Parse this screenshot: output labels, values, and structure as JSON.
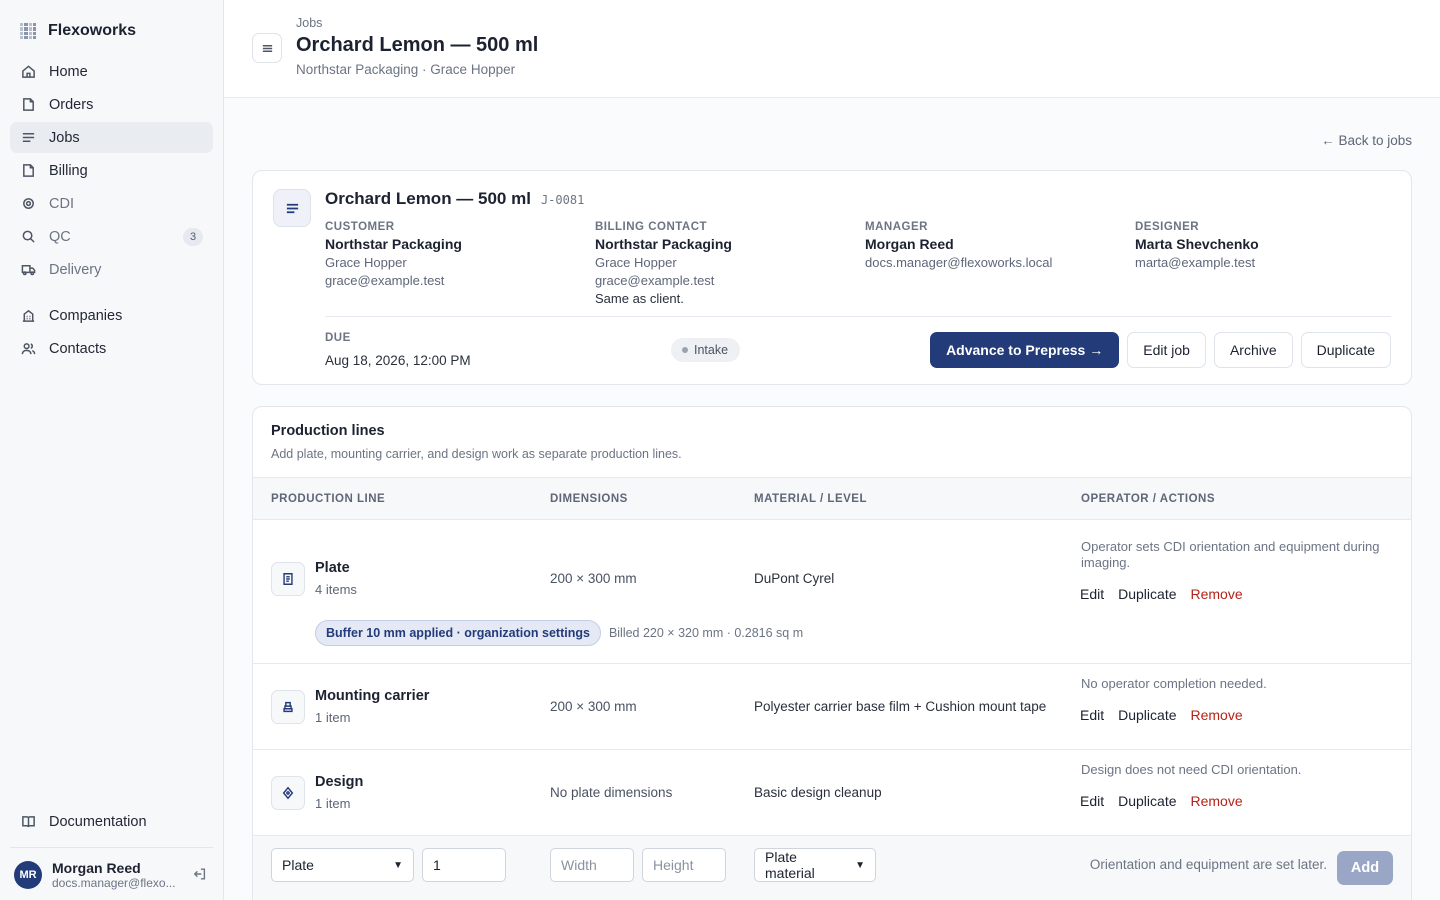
{
  "brand": {
    "name": "Flexoworks"
  },
  "nav": {
    "items": [
      {
        "label": "Home",
        "icon": "home-icon"
      },
      {
        "label": "Orders",
        "icon": "folder-icon"
      },
      {
        "label": "Jobs",
        "icon": "list-icon",
        "active": true
      },
      {
        "label": "Billing",
        "icon": "folder-icon"
      },
      {
        "label": "CDI",
        "icon": "target-icon"
      },
      {
        "label": "QC",
        "icon": "search-icon",
        "badge": "3"
      },
      {
        "label": "Delivery",
        "icon": "truck-icon"
      },
      {
        "label": "Companies",
        "icon": "building-icon"
      },
      {
        "label": "Contacts",
        "icon": "users-icon"
      }
    ],
    "documentation": "Documentation"
  },
  "user": {
    "initials": "MR",
    "name": "Morgan Reed",
    "email": "docs.manager@flexo..."
  },
  "header": {
    "breadcrumb": "Jobs",
    "title": "Orchard Lemon — 500 ml",
    "subtitle": "Northstar Packaging · Grace Hopper"
  },
  "back_link": "← Back to jobs",
  "job": {
    "title": "Orchard Lemon — 500 ml",
    "id": "J-0081",
    "customer": {
      "label": "CUSTOMER",
      "company": "Northstar Packaging",
      "person": "Grace Hopper",
      "email": "grace@example.test"
    },
    "billing": {
      "label": "BILLING CONTACT",
      "company": "Northstar Packaging",
      "person": "Grace Hopper",
      "email": "grace@example.test",
      "note": "Same as client."
    },
    "manager": {
      "label": "MANAGER",
      "name": "Morgan Reed",
      "email": "docs.manager@flexoworks.local"
    },
    "designer": {
      "label": "DESIGNER",
      "name": "Marta Shevchenko",
      "email": "marta@example.test"
    },
    "due": {
      "label": "DUE",
      "value": "Aug 18, 2026, 12:00 PM"
    },
    "status": "Intake",
    "actions": {
      "advance": "Advance to Prepress →",
      "edit": "Edit job",
      "archive": "Archive",
      "duplicate": "Duplicate"
    }
  },
  "production": {
    "title": "Production lines",
    "subtitle": "Add plate, mounting carrier, and design work as separate production lines.",
    "columns": [
      "PRODUCTION LINE",
      "DIMENSIONS",
      "MATERIAL / LEVEL",
      "OPERATOR / ACTIONS"
    ],
    "rows": [
      {
        "name": "Plate",
        "count": "4 items",
        "icon": "document-icon",
        "dimensions": "200 × 300 mm",
        "material": "DuPont Cyrel",
        "note": "Operator sets CDI orientation and equipment during imaging.",
        "buffer": "Buffer 10 mm applied · organization settings",
        "billed": "Billed 220 × 320 mm · 0.2816 sq m"
      },
      {
        "name": "Mounting carrier",
        "count": "1 item",
        "icon": "layers-icon",
        "dimensions": "200 × 300 mm",
        "material": "Polyester carrier base film + Cushion mount tape",
        "note": "No operator completion needed."
      },
      {
        "name": "Design",
        "count": "1 item",
        "icon": "pen-icon",
        "dimensions": "No plate dimensions",
        "material": "Basic design cleanup",
        "note": "Design does not need CDI orientation."
      }
    ],
    "row_actions": {
      "edit": "Edit",
      "duplicate": "Duplicate",
      "remove": "Remove"
    },
    "add_form": {
      "type_value": "Plate",
      "quantity_value": "1",
      "width_placeholder": "Width",
      "height_placeholder": "Height",
      "material_value": "Plate material",
      "note": "Orientation and equipment are set later.",
      "add_label": "Add"
    }
  },
  "colors": {
    "primary": "#243b7a",
    "danger": "#b42318",
    "sidebar_bg": "#f7f8fa"
  }
}
